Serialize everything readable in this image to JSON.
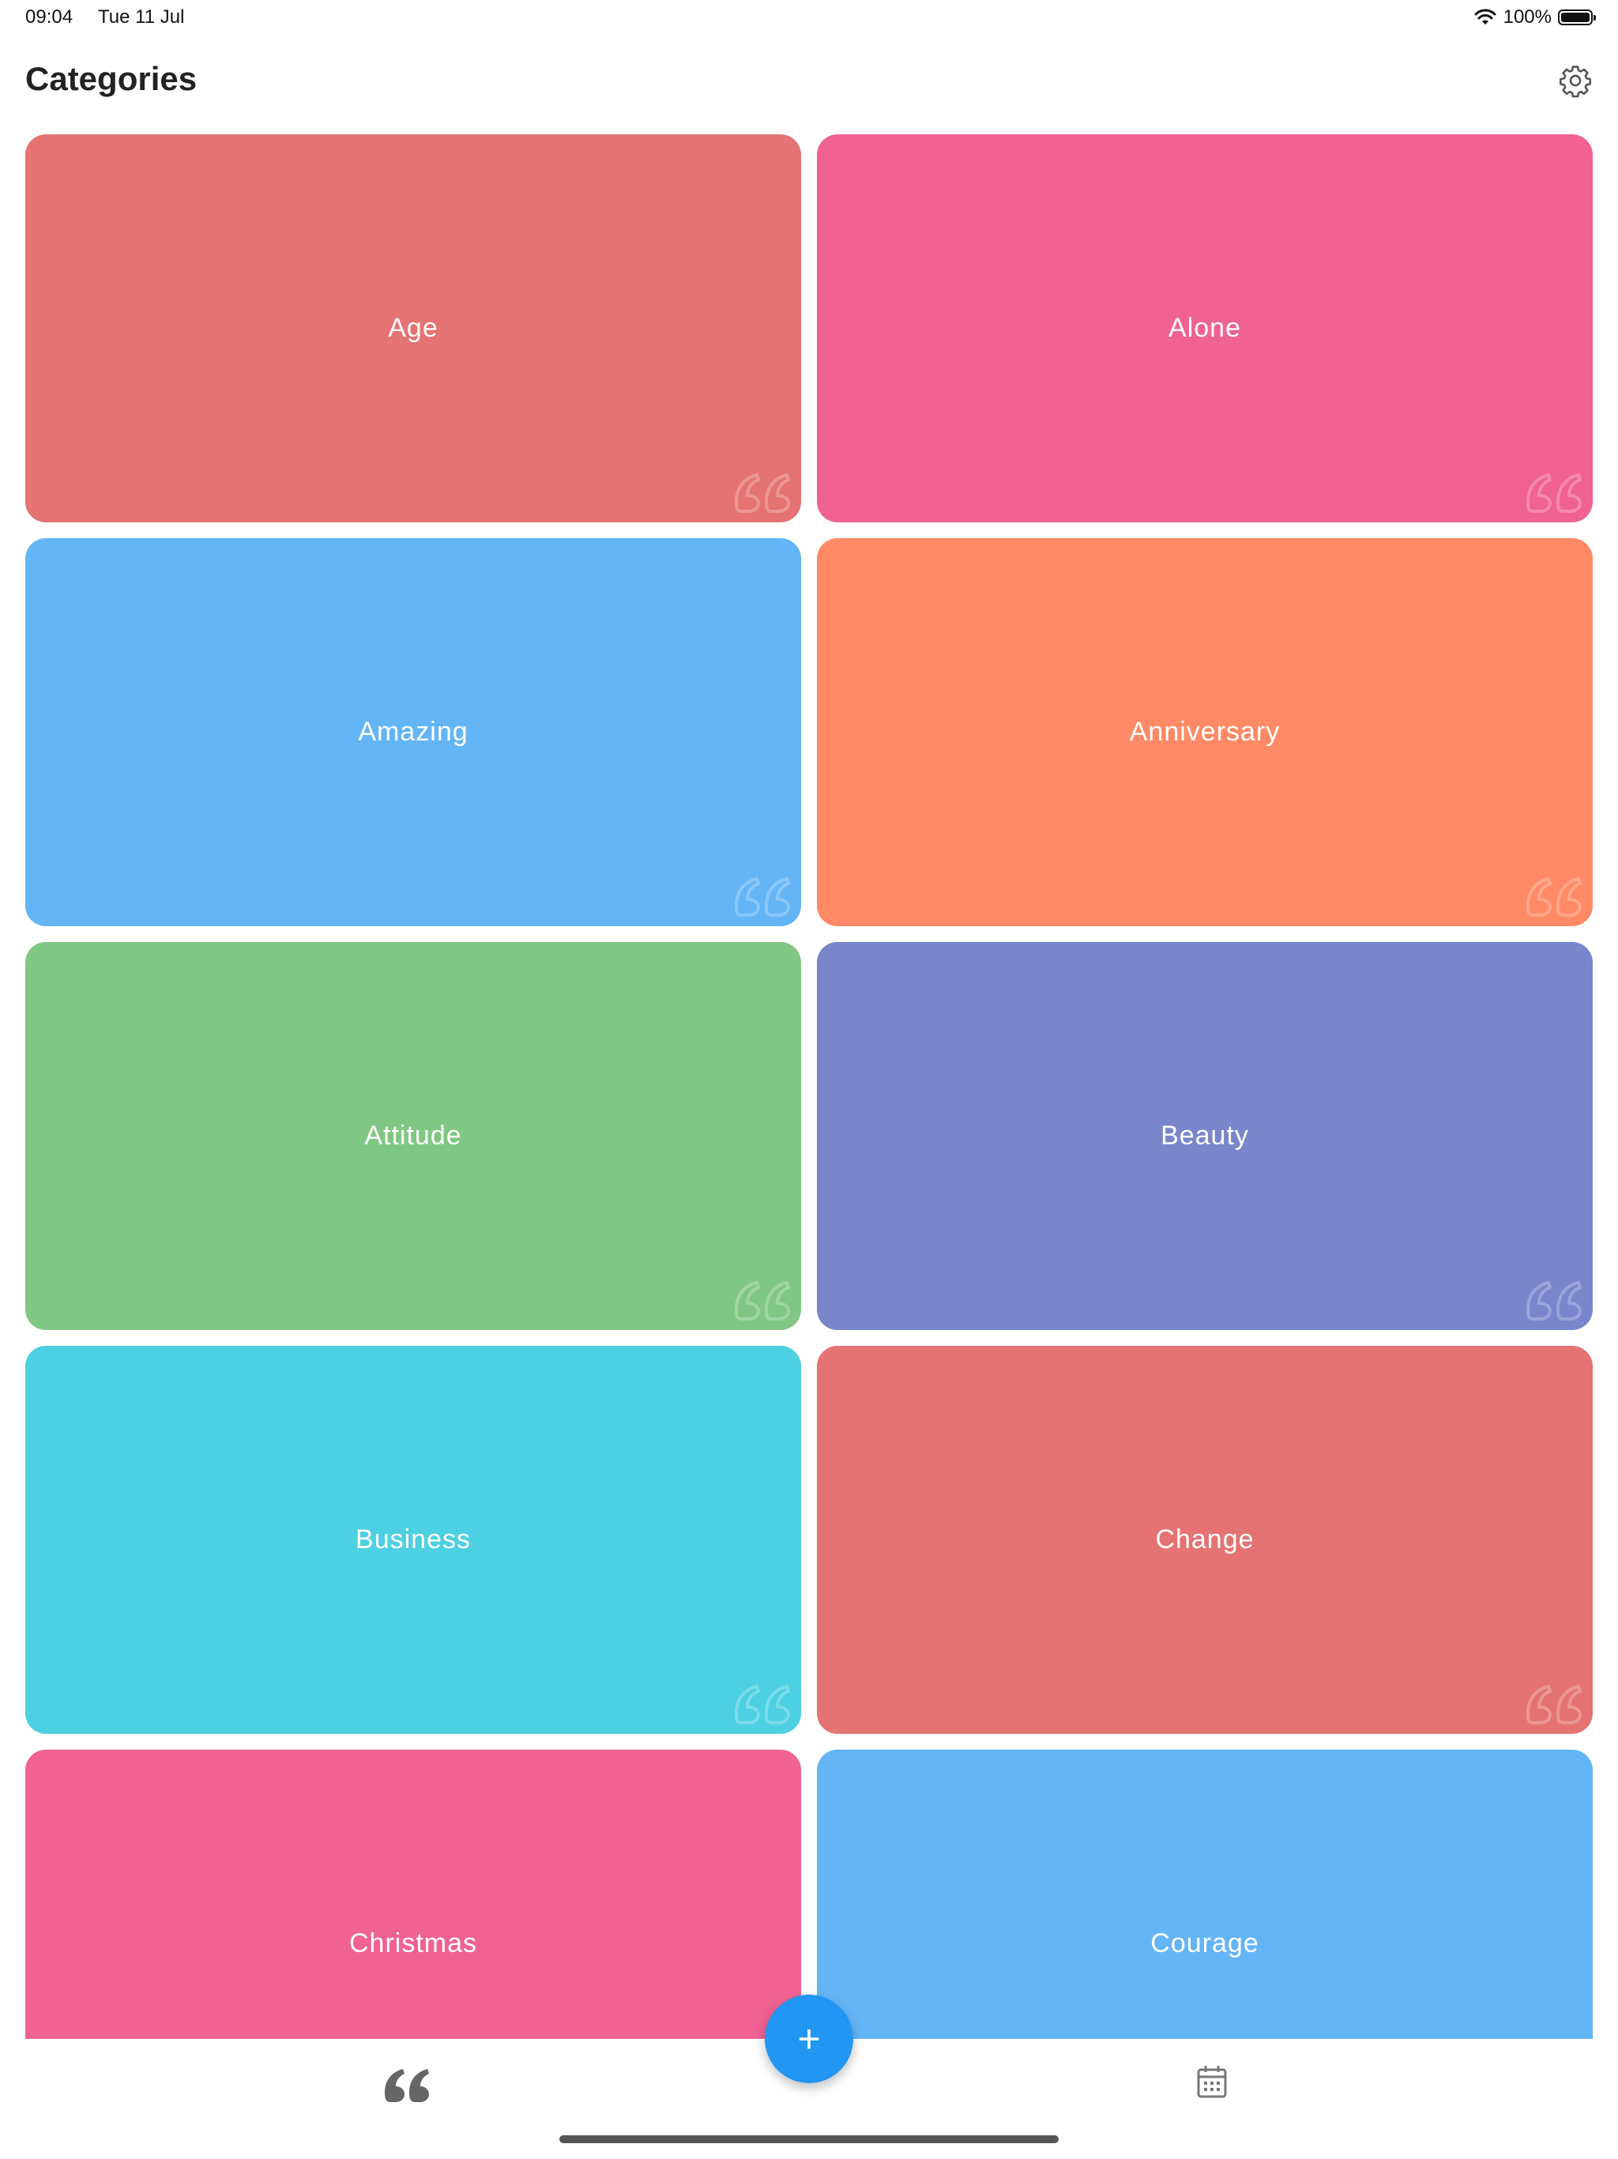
{
  "status_bar": {
    "time": "09:04",
    "date": "Tue 11 Jul",
    "battery": "100%",
    "wifi_icon": "wifi-icon",
    "battery_icon": "battery-icon"
  },
  "header": {
    "title": "Categories",
    "settings_icon": "gear-icon"
  },
  "categories": [
    {
      "label": "Age",
      "color": "#e57373"
    },
    {
      "label": "Alone",
      "color": "#f06292"
    },
    {
      "label": "Amazing",
      "color": "#64b5f6"
    },
    {
      "label": "Anniversary",
      "color": "#ff8a65"
    },
    {
      "label": "Attitude",
      "color": "#81c784"
    },
    {
      "label": "Beauty",
      "color": "#7986cb"
    },
    {
      "label": "Business",
      "color": "#4dd0e1"
    },
    {
      "label": "Change",
      "color": "#e57373"
    },
    {
      "label": "Christmas",
      "color": "#f06292"
    },
    {
      "label": "Courage",
      "color": "#64b5f6"
    }
  ],
  "fab": {
    "label": "+",
    "color": "#2196f3"
  },
  "bottom_nav": {
    "quotes_icon": "quote-icon",
    "calendar_icon": "calendar-icon"
  }
}
